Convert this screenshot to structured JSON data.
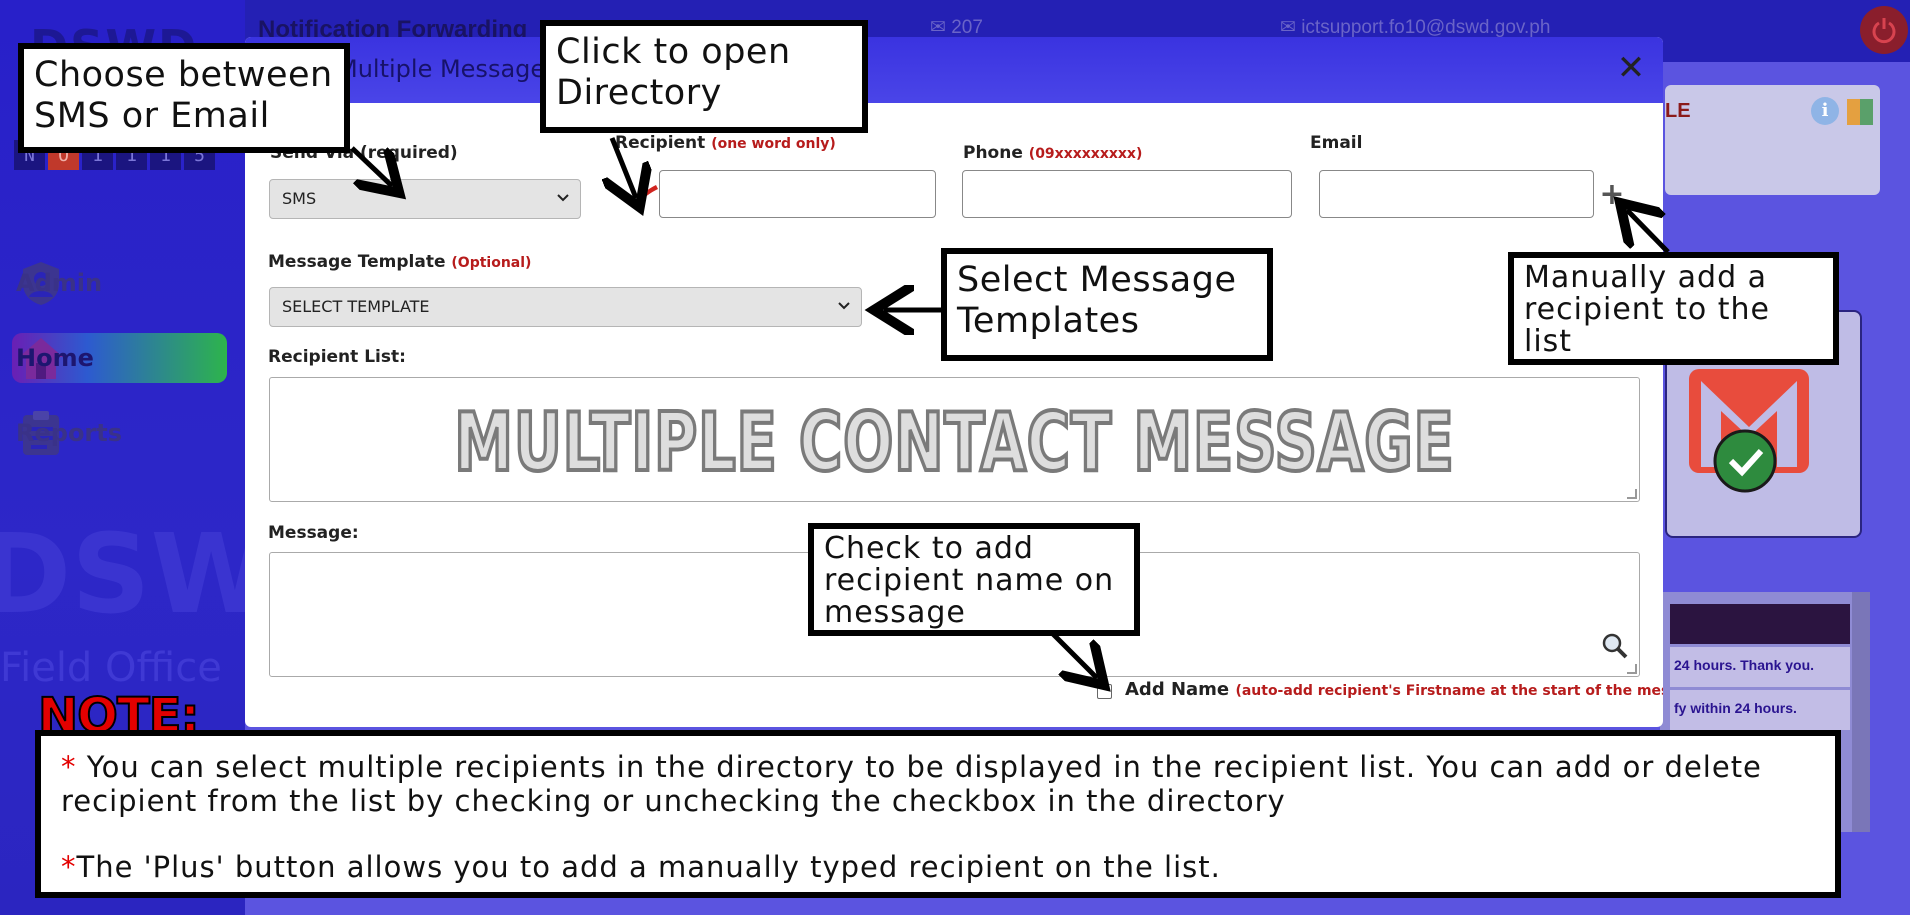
{
  "background": {
    "logo_text": "DSWD",
    "counter_digits": [
      "N",
      "O",
      "1",
      "1",
      "1",
      "5"
    ],
    "header_title": "Notification Forwarding",
    "message_count": "207",
    "support_email": "ictsupport.fo10@dswd.gov.ph",
    "watermark": "DSWD",
    "watermark2": "Field Office",
    "nav": [
      {
        "label": "Admin",
        "icon": "admin-user-icon"
      },
      {
        "label": "Home",
        "icon": "home-icon"
      },
      {
        "label": "Reports",
        "icon": "clipboard-icon"
      }
    ],
    "right_card_title": "LE",
    "right_list_rows": [
      "24 hours. Thank you.",
      "fy within 24 hours."
    ]
  },
  "modal": {
    "title": "Multiple Message",
    "close_label": "✕",
    "send_via": {
      "label": "Send Via (required)",
      "selected": "SMS"
    },
    "recipient": {
      "label": "Recipient",
      "hint": "(one word only)",
      "value": ""
    },
    "phone": {
      "label": "Phone",
      "hint": "(09xxxxxxxxx)",
      "value": ""
    },
    "email": {
      "label": "Email",
      "value": ""
    },
    "plus_label": "+",
    "message_template": {
      "label": "Message Template",
      "hint": "(Optional)",
      "selected": "SELECT TEMPLATE"
    },
    "recipient_list": {
      "label": "Recipient List:",
      "overlay": "MULTIPLE CONTACT MESSAGE"
    },
    "message": {
      "label": "Message:",
      "value": ""
    },
    "add_name": {
      "label": "Add Name",
      "hint": "(auto-add recipient's Firstname at the start of the message.)"
    }
  },
  "callouts": {
    "send_via": "Choose between SMS or Email",
    "directory": "Click to open Directory",
    "templates": "Select Message Templates",
    "manual_add": "Manually add a recipient to the list",
    "add_name": "Check to add recipient name on message"
  },
  "note": {
    "title": "NOTE:",
    "line1_star": "*",
    "line1": " You can select multiple recipients in the directory to be displayed in the recipient list. You can add or delete recipient from the list by checking or unchecking the checkbox in the directory",
    "line2_star": "*",
    "line2": "The 'Plus' button allows you to add a manually typed recipient on the list."
  },
  "colors": {
    "accent": "#3a33e0",
    "note_red": "#e30000",
    "required_red": "#b71c1c"
  }
}
